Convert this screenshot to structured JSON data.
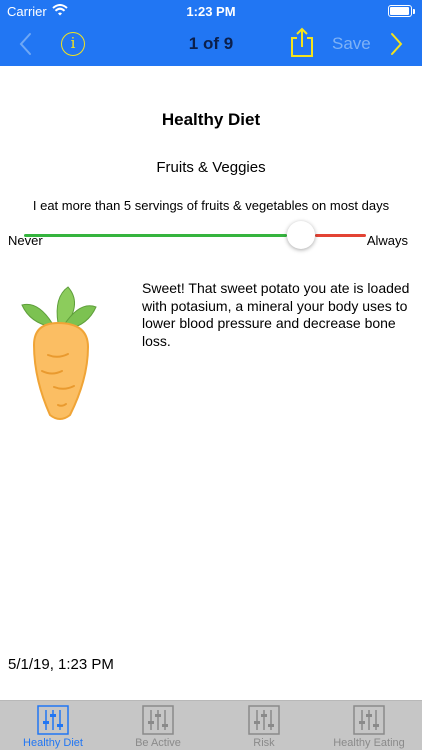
{
  "status_bar": {
    "carrier": "Carrier",
    "time": "1:23 PM"
  },
  "nav_bar": {
    "back_icon": "chevron-left-icon",
    "info_icon": "info-icon",
    "info_glyph": "i",
    "title": "1 of 9",
    "share_icon": "share-icon",
    "save_label": "Save",
    "forward_icon": "chevron-right-icon"
  },
  "main": {
    "title": "Healthy Diet",
    "subtitle": "Fruits & Veggies",
    "question": "I eat more than 5 servings of fruits & vegetables on most days",
    "slider": {
      "min_label": "Never",
      "max_label": "Always",
      "value": 0.81
    },
    "illustration_icon": "carrot-icon",
    "feedback": "Sweet! That sweet potato you ate is loaded with potasium, a mineral your body uses to lower blood pressure and decrease bone loss.",
    "timestamp": "5/1/19, 1:23 PM"
  },
  "tab_bar": {
    "tabs": [
      {
        "label": "Healthy Diet",
        "icon": "sliders-icon",
        "active": true
      },
      {
        "label": "Be Active",
        "icon": "sliders-icon",
        "active": false
      },
      {
        "label": "Risk",
        "icon": "sliders-icon",
        "active": false
      },
      {
        "label": "Healthy Eating",
        "icon": "sliders-icon",
        "active": false
      }
    ]
  },
  "colors": {
    "brand_blue": "#2176f3",
    "info_yellow": "#f4e31d",
    "slider_green": "#35b43e",
    "slider_red": "#e34334",
    "carrot_orange": "#fbbe63",
    "leaf_green": "#7cc251"
  }
}
